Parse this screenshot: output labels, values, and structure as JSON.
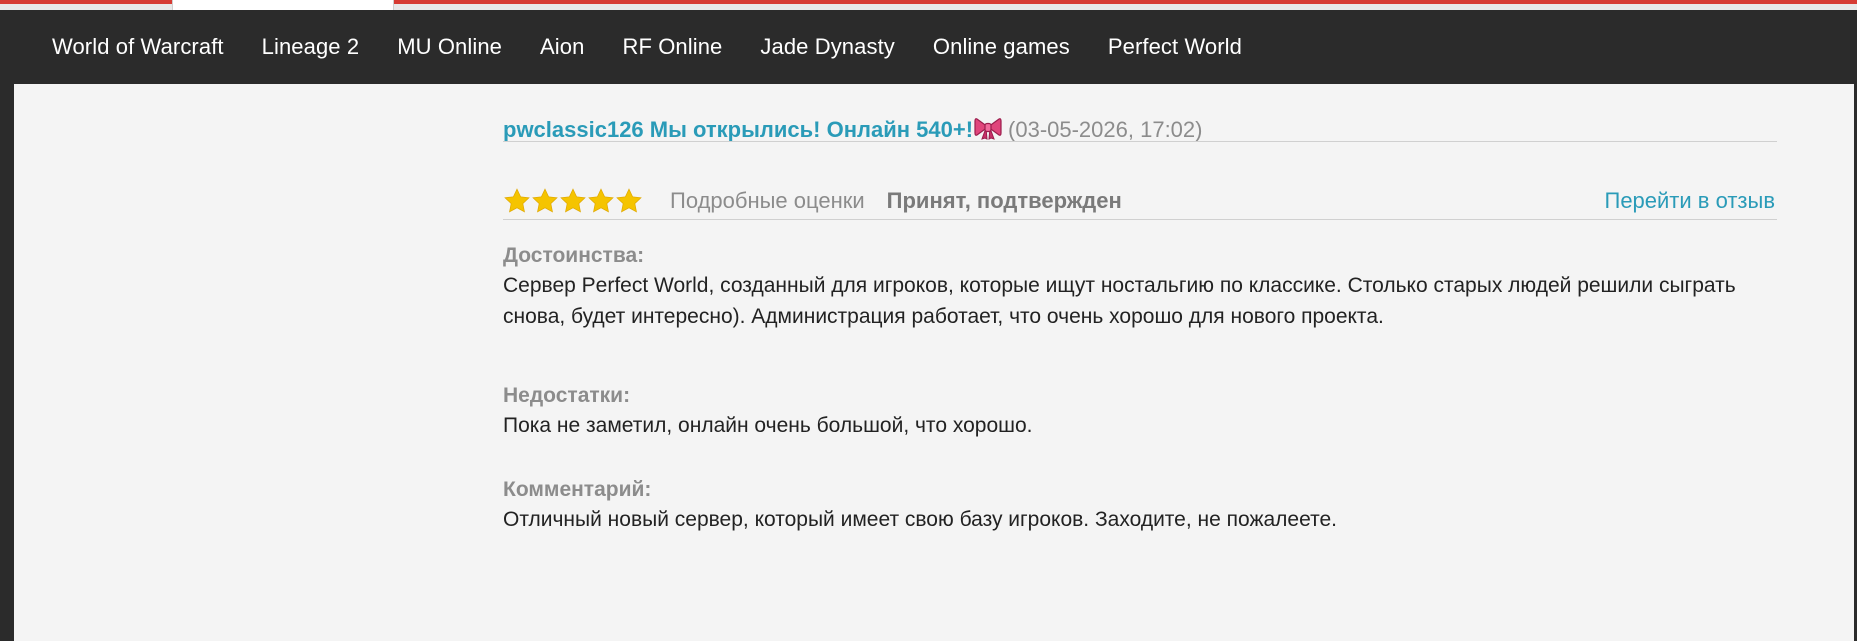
{
  "nav": {
    "items": [
      {
        "label": "World of Warcraft"
      },
      {
        "label": "Lineage 2"
      },
      {
        "label": "MU Online"
      },
      {
        "label": "Aion"
      },
      {
        "label": "RF Online"
      },
      {
        "label": "Jade Dynasty"
      },
      {
        "label": "Online games"
      },
      {
        "label": "Perfect World"
      }
    ]
  },
  "review": {
    "title": "pwclassic126 Мы открылись! Онлайн 540+!",
    "title_icon": "ribbon-bow-icon",
    "date": "(03-05-2026, 17:02)",
    "rating": 5,
    "rating_max": 5,
    "detailed_ratings_label": "Подробные оценки",
    "status": "Принят, подтвержден",
    "goto_label": "Перейти в отзыв",
    "pros_label": "Достоинства:",
    "pros_text": "Сервер Perfect World, созданный для игроков, которые ищут ностальгию по классике. Столько старых людей решили сыграть снова, будет интересно). Администрация работает, что очень хорошо для нового проекта.",
    "cons_label": "Недостатки:",
    "cons_text": "Пока не заметил, онлайн очень большой, что хорошо.",
    "comment_label": "Комментарий:",
    "comment_text": "Отличный новый сервер, который имеет свою базу игроков. Заходите, не пожалеете."
  },
  "colors": {
    "accent_link": "#2a9bb8",
    "star": "#f5c400",
    "navbar": "#2b2b2b",
    "browser_accent": "#d63b33"
  }
}
